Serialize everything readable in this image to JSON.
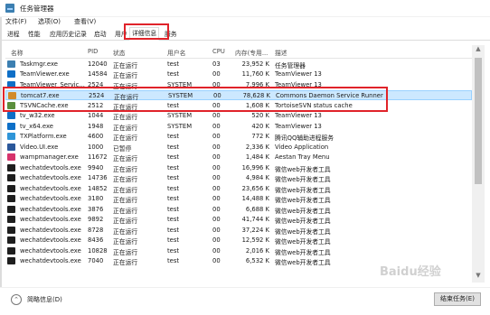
{
  "window": {
    "title": "任务管理器"
  },
  "menu": [
    "文件(F)",
    "选项(O)",
    "查看(V)"
  ],
  "tabs": [
    "进程",
    "性能",
    "应用历史记录",
    "启动",
    "用户",
    "详细信息",
    "服务"
  ],
  "active_tab": "详细信息",
  "columns": [
    "名称",
    "PID",
    "状态",
    "用户名",
    "CPU",
    "内存(专用...",
    "描述"
  ],
  "rows": [
    {
      "name": "Taskmgr.exe",
      "pid": "12040",
      "status": "正在运行",
      "user": "test",
      "cpu": "03",
      "mem": "23,952 K",
      "desc": "任务管理器",
      "icon_color": "#3c7fb1",
      "icon": "taskmgr-icon"
    },
    {
      "name": "TeamViewer.exe",
      "pid": "14584",
      "status": "正在运行",
      "user": "test",
      "cpu": "00",
      "mem": "11,760 K",
      "desc": "TeamViewer 13",
      "icon_color": "#0e6fc7",
      "icon": "teamviewer-icon"
    },
    {
      "name": "TeamViewer_Servic...",
      "pid": "2524",
      "status": "正在运行",
      "user": "SYSTEM",
      "cpu": "00",
      "mem": "7,996 K",
      "desc": "TeamViewer 13",
      "icon_color": "#0e6fc7",
      "icon": "teamviewer-icon"
    },
    {
      "name": "tomcat7.exe",
      "pid": "2524",
      "status": "正在运行",
      "user": "SYSTEM",
      "cpu": "00",
      "mem": "78,628 K",
      "desc": "Commons Daemon Service Runner",
      "icon_color": "#d28a2a",
      "icon": "tomcat-icon"
    },
    {
      "name": "TSVNCache.exe",
      "pid": "2512",
      "status": "正在运行",
      "user": "test",
      "cpu": "00",
      "mem": "1,608 K",
      "desc": "TortoiseSVN status cache",
      "icon_color": "#5a8f3d",
      "icon": "tortoisesvn-icon"
    },
    {
      "name": "tv_w32.exe",
      "pid": "1044",
      "status": "正在运行",
      "user": "SYSTEM",
      "cpu": "00",
      "mem": "520 K",
      "desc": "TeamViewer 13",
      "icon_color": "#0e6fc7",
      "icon": "teamviewer-icon"
    },
    {
      "name": "tv_x64.exe",
      "pid": "1948",
      "status": "正在运行",
      "user": "SYSTEM",
      "cpu": "00",
      "mem": "420 K",
      "desc": "TeamViewer 13",
      "icon_color": "#0e6fc7",
      "icon": "teamviewer-icon"
    },
    {
      "name": "TXPlatform.exe",
      "pid": "4600",
      "status": "正在运行",
      "user": "test",
      "cpu": "00",
      "mem": "772 K",
      "desc": "腾讯QQ辅助进程服务",
      "icon_color": "#2f95d8",
      "icon": "qq-icon"
    },
    {
      "name": "Video.UI.exe",
      "pid": "1000",
      "status": "已暂停",
      "user": "test",
      "cpu": "00",
      "mem": "2,336 K",
      "desc": "Video Application",
      "icon_color": "#2b579a",
      "icon": "video-icon"
    },
    {
      "name": "wampmanager.exe",
      "pid": "11672",
      "status": "正在运行",
      "user": "test",
      "cpu": "00",
      "mem": "1,484 K",
      "desc": "Aestan Tray Menu",
      "icon_color": "#d6336c",
      "icon": "wamp-icon"
    },
    {
      "name": "wechatdevtools.exe",
      "pid": "9940",
      "status": "正在运行",
      "user": "test",
      "cpu": "00",
      "mem": "16,996 K",
      "desc": "微信web开发者工具",
      "icon_color": "#1f1f1f",
      "icon": "wechat-devtools-icon"
    },
    {
      "name": "wechatdevtools.exe",
      "pid": "14736",
      "status": "正在运行",
      "user": "test",
      "cpu": "00",
      "mem": "4,984 K",
      "desc": "微信web开发者工具",
      "icon_color": "#1f1f1f",
      "icon": "wechat-devtools-icon"
    },
    {
      "name": "wechatdevtools.exe",
      "pid": "14852",
      "status": "正在运行",
      "user": "test",
      "cpu": "00",
      "mem": "23,656 K",
      "desc": "微信web开发者工具",
      "icon_color": "#1f1f1f",
      "icon": "wechat-devtools-icon"
    },
    {
      "name": "wechatdevtools.exe",
      "pid": "3180",
      "status": "正在运行",
      "user": "test",
      "cpu": "00",
      "mem": "14,488 K",
      "desc": "微信web开发者工具",
      "icon_color": "#1f1f1f",
      "icon": "wechat-devtools-icon"
    },
    {
      "name": "wechatdevtools.exe",
      "pid": "3876",
      "status": "正在运行",
      "user": "test",
      "cpu": "00",
      "mem": "6,688 K",
      "desc": "微信web开发者工具",
      "icon_color": "#1f1f1f",
      "icon": "wechat-devtools-icon"
    },
    {
      "name": "wechatdevtools.exe",
      "pid": "9892",
      "status": "正在运行",
      "user": "test",
      "cpu": "00",
      "mem": "41,744 K",
      "desc": "微信web开发者工具",
      "icon_color": "#1f1f1f",
      "icon": "wechat-devtools-icon"
    },
    {
      "name": "wechatdevtools.exe",
      "pid": "8728",
      "status": "正在运行",
      "user": "test",
      "cpu": "00",
      "mem": "37,224 K",
      "desc": "微信web开发者工具",
      "icon_color": "#1f1f1f",
      "icon": "wechat-devtools-icon"
    },
    {
      "name": "wechatdevtools.exe",
      "pid": "8436",
      "status": "正在运行",
      "user": "test",
      "cpu": "00",
      "mem": "12,592 K",
      "desc": "微信web开发者工具",
      "icon_color": "#1f1f1f",
      "icon": "wechat-devtools-icon"
    },
    {
      "name": "wechatdevtools.exe",
      "pid": "10828",
      "status": "正在运行",
      "user": "test",
      "cpu": "00",
      "mem": "2,016 K",
      "desc": "微信web开发者工具",
      "icon_color": "#1f1f1f",
      "icon": "wechat-devtools-icon"
    },
    {
      "name": "wechatdevtools.exe",
      "pid": "7040",
      "status": "正在运行",
      "user": "test",
      "cpu": "00",
      "mem": "6,532 K",
      "desc": "微信web开发者工具",
      "icon_color": "#1f1f1f",
      "icon": "wechat-devtools-icon"
    }
  ],
  "selected_row": 3,
  "footer": {
    "fewer_details": "简略信息(D)",
    "end_task": "结束任务(E)"
  },
  "watermark": "Baidu经验",
  "colors": {
    "highlight_box": "#e0232a",
    "selection": "#cce8ff"
  }
}
